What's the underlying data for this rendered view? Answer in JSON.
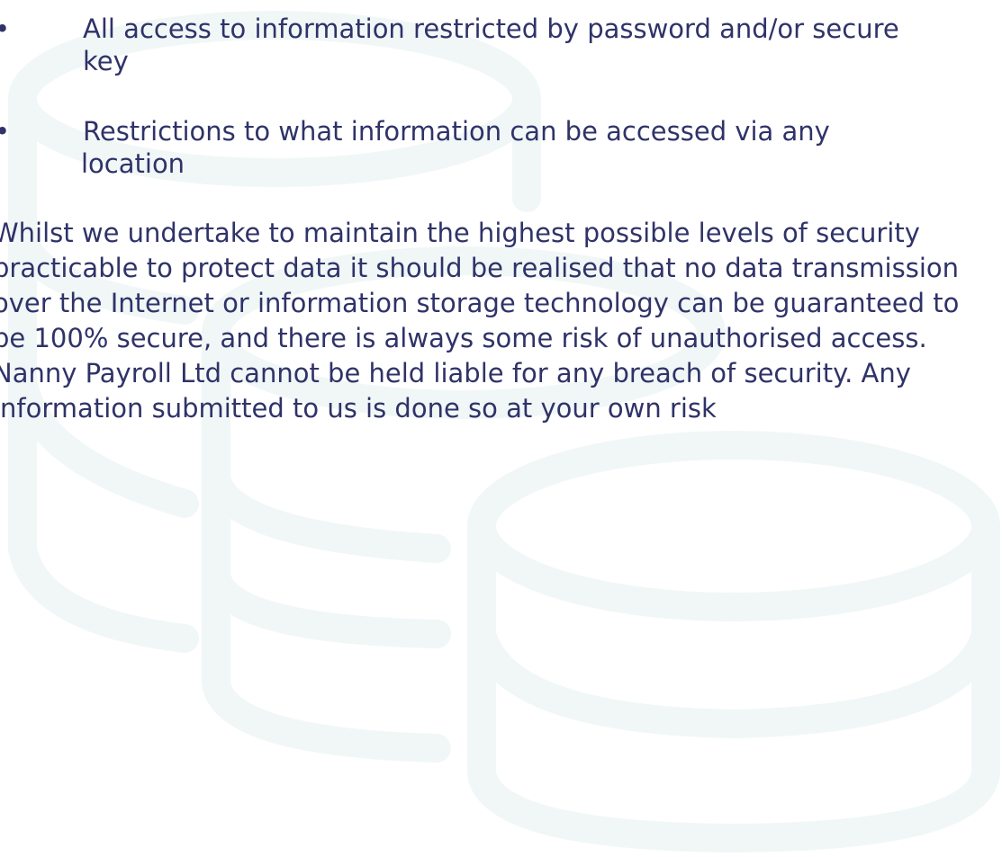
{
  "list": {
    "bullet_symbol": "•",
    "items": [
      {
        "text": "All access to information restricted by password and/or secure key"
      },
      {
        "text": "Restrictions to what information can be accessed via any location"
      }
    ]
  },
  "paragraph": {
    "text": "Whilst we undertake to maintain the highest possible levels of security practicable to protect data it should be realised that no data transmission over the Internet or information storage technology can be guaranteed to be 100% secure, and there is always some risk of unauthorised access. Nanny Payroll Ltd cannot be held liable for any breach of security. Any information submitted to us is done so at your own risk"
  },
  "colors": {
    "text": "#2f3368",
    "background_art": "#f1f7f7",
    "background": "#ffffff"
  },
  "background": {
    "icon": "database-stack-icon"
  }
}
